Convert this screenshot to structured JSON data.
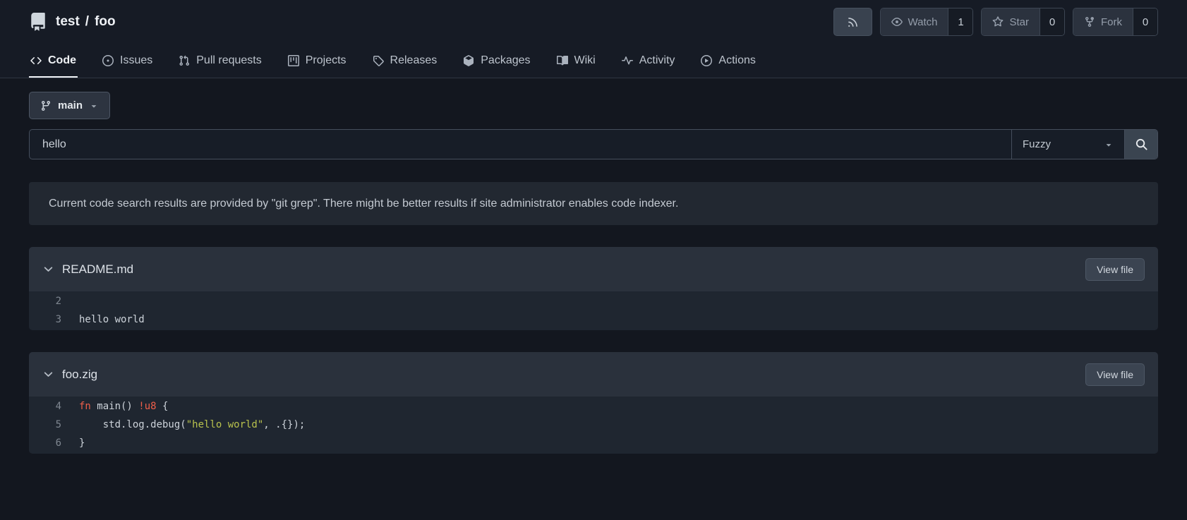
{
  "repo": {
    "owner": "test",
    "separator": "/",
    "name": "foo"
  },
  "actions_bar": {
    "rss_button": {
      "icon": "rss-icon"
    },
    "watch": {
      "label": "Watch",
      "count": "1",
      "icon": "eye-icon"
    },
    "star": {
      "label": "Star",
      "count": "0",
      "icon": "star-icon"
    },
    "fork": {
      "label": "Fork",
      "count": "0",
      "icon": "git-fork-icon"
    }
  },
  "tabs": [
    {
      "label": "Code",
      "icon": "code-icon",
      "active": true
    },
    {
      "label": "Issues",
      "icon": "issue-opened-icon",
      "active": false
    },
    {
      "label": "Pull requests",
      "icon": "git-pull-request-icon",
      "active": false
    },
    {
      "label": "Projects",
      "icon": "project-board-icon",
      "active": false
    },
    {
      "label": "Releases",
      "icon": "tag-icon",
      "active": false
    },
    {
      "label": "Packages",
      "icon": "package-icon",
      "active": false
    },
    {
      "label": "Wiki",
      "icon": "book-icon",
      "active": false
    },
    {
      "label": "Activity",
      "icon": "pulse-icon",
      "active": false
    },
    {
      "label": "Actions",
      "icon": "play-circle-icon",
      "active": false
    }
  ],
  "branch_selector": {
    "label": "main",
    "icon": "git-branch-icon"
  },
  "search": {
    "value": "hello",
    "mode": "Fuzzy",
    "button_icon": "search-icon"
  },
  "notice": {
    "text": "Current code search results are provided by \"git grep\". There might be better results if site administrator enables code indexer."
  },
  "results": [
    {
      "filename": "README.md",
      "view_button": "View file",
      "lines": [
        {
          "num": "2",
          "code": [
            ""
          ]
        },
        {
          "num": "3",
          "code": [
            "hello world"
          ]
        }
      ]
    },
    {
      "filename": "foo.zig",
      "view_button": "View file",
      "lines": [
        {
          "num": "4",
          "code": [
            "fn",
            " main() ",
            "!u8",
            " {"
          ]
        },
        {
          "num": "5",
          "code": [
            "    std.log.debug(",
            "\"hello world\"",
            ", .{});"
          ]
        },
        {
          "num": "6",
          "code": [
            "}"
          ]
        }
      ]
    }
  ],
  "colors": {
    "page_bg": "#13171f",
    "header_bg": "#161b25",
    "panel_bg": "#222831",
    "box_header_bg": "#2a313c",
    "code_bg": "#1f2630",
    "keyword": "#ee5f4a",
    "string": "#b9c24d",
    "active_tab_underline": "#f1f4f7"
  }
}
